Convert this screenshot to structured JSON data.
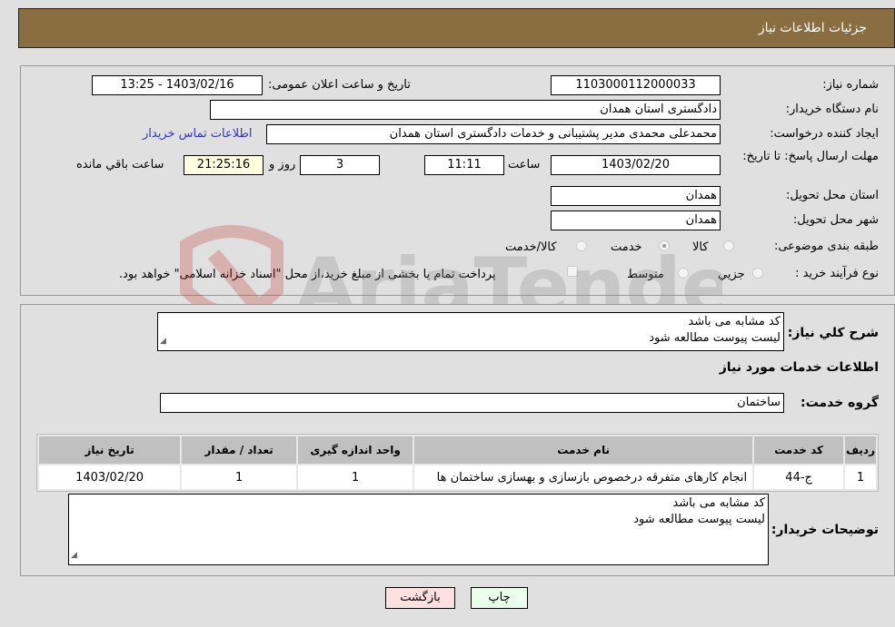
{
  "header": {
    "title": "جزئیات اطلاعات نیاز"
  },
  "details": {
    "need_number_label": "شماره نیاز:",
    "need_number": "1103000112000033",
    "announce_label": "تاریخ و ساعت اعلان عمومی:",
    "announce_value": "1403/02/16 - 13:25",
    "buyer_org_label": "نام دستگاه خریدار:",
    "buyer_org": "دادگستری استان همدان",
    "creator_label": "ایجاد کننده درخواست:",
    "creator": "محمدعلی محمدی مدیر پشتیبانی و خدمات دادگستری استان همدان",
    "contact_link": "اطلاعات تماس خریدار",
    "deadline_label": "مهلت ارسال پاسخ: تا تاریخ:",
    "deadline_date": "1403/02/20",
    "time_label": "ساعت",
    "deadline_time": "11:11",
    "days_value": "3",
    "days_label": "روز و",
    "remaining_time": "21:25:16",
    "remaining_label": "ساعت باقي مانده",
    "province_label": "استان محل تحویل:",
    "province": "همدان",
    "city_label": "شهر محل تحویل:",
    "city": "همدان",
    "category_label": "طبقه بندی موضوعی:",
    "category_options": [
      {
        "label": "کالا",
        "selected": false
      },
      {
        "label": "خدمت",
        "selected": true
      },
      {
        "label": "کالا/خدمت",
        "selected": false
      }
    ],
    "process_label": "نوع فرآیند خرید :",
    "process_options": [
      {
        "label": "جزيي",
        "selected": false
      },
      {
        "label": "متوسط",
        "selected": false
      }
    ],
    "payment_note": "پرداخت تمام یا بخشی از مبلغ خرید،از محل \"اسناد خزانه اسلامی\" خواهد بود."
  },
  "summary": {
    "label": "شرح كلي نياز:",
    "lines": [
      "کد مشابه می باشد",
      "لیست پیوست مطالعه شود"
    ],
    "services_heading": "اطلاعات خدمات مورد نیاز",
    "service_group_label": "گروه خدمت:",
    "service_group": "ساختمان"
  },
  "table": {
    "headers": [
      "ردیف",
      "کد خدمت",
      "نام خدمت",
      "واحد اندازه گیری",
      "تعداد / مقدار",
      "تاریخ نیاز"
    ],
    "rows": [
      [
        "1",
        "ج-44",
        "انجام کارهای متفرقه درخصوص بازسازی و بهسازی ساختمان ها",
        "1",
        "1",
        "1403/02/20"
      ]
    ]
  },
  "buyer_notes": {
    "label": "توضیحات خریدار:",
    "lines": [
      "کد مشابه می باشد",
      "لیست پیوست مطالعه شود"
    ]
  },
  "buttons": {
    "print": "چاپ",
    "back": "بازگشت"
  },
  "watermark": {
    "text": "AriaTender.neT"
  }
}
